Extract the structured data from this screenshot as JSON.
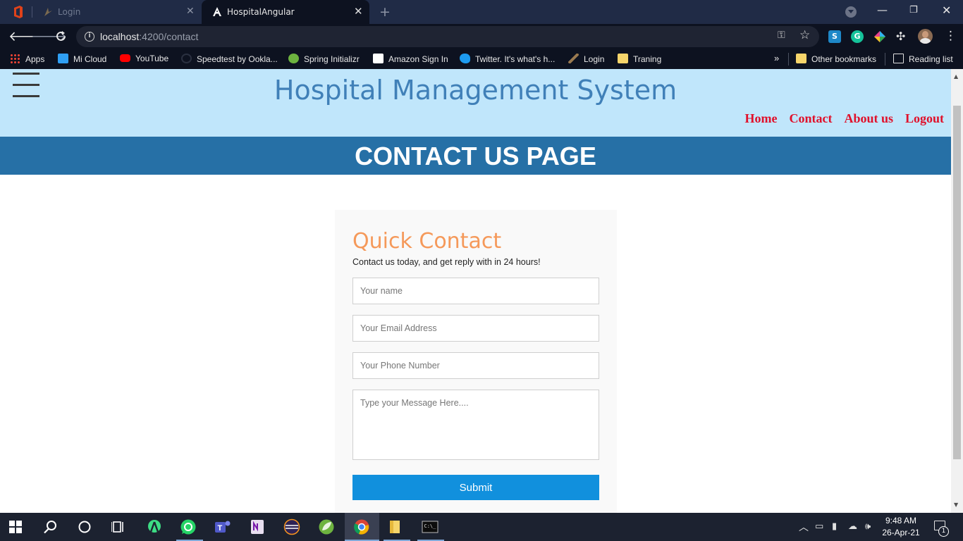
{
  "browser": {
    "tabs": [
      {
        "title": "Login",
        "active": false
      },
      {
        "title": "HospitalAngular",
        "active": true
      }
    ],
    "url_host": "localhost",
    "url_path": ":4200/contact",
    "bookmarks": [
      {
        "label": "Apps",
        "icon": "apps-grid-icon"
      },
      {
        "label": "Mi Cloud",
        "icon": "mi-cloud-icon"
      },
      {
        "label": "YouTube",
        "icon": "youtube-icon"
      },
      {
        "label": "Speedtest by Ookla...",
        "icon": "speedtest-icon"
      },
      {
        "label": "Spring Initializr",
        "icon": "spring-icon"
      },
      {
        "label": "Amazon Sign In",
        "icon": "amazon-icon"
      },
      {
        "label": "Twitter. It's what's h...",
        "icon": "twitter-icon"
      },
      {
        "label": "Login",
        "icon": "login-icon"
      },
      {
        "label": "Traning",
        "icon": "folder-icon"
      }
    ],
    "other_bookmarks": "Other bookmarks",
    "reading_list": "Reading list",
    "overflow": "»"
  },
  "page": {
    "site_title": "Hospital Management System",
    "nav": [
      "Home",
      "Contact",
      "About us",
      "Logout"
    ],
    "banner": "CONTACT US PAGE",
    "contact_form": {
      "heading": "Quick Contact",
      "subheading": "Contact us today, and get reply with in 24 hours!",
      "name_placeholder": "Your name",
      "email_placeholder": "Your Email Address",
      "phone_placeholder": "Your Phone Number",
      "message_placeholder": "Type your Message Here....",
      "submit_label": "Submit"
    }
  },
  "taskbar": {
    "time": "9:48 AM",
    "date": "26-Apr-21",
    "notification_count": "1",
    "pinned": [
      "windows-start-icon",
      "search-icon",
      "cortana-icon",
      "task-view-icon",
      "android-studio-icon",
      "whatsapp-icon",
      "teams-icon",
      "onenote-icon",
      "eclipse-icon",
      "spring-tool-icon",
      "chrome-icon",
      "file-explorer-icon",
      "terminal-icon"
    ]
  },
  "colors": {
    "header_bg": "#c0e6fb",
    "title_color": "#4080b8",
    "nav_color": "#e0102a",
    "banner_bg": "#2670a6",
    "heading_color": "#f5995a",
    "submit_bg": "#1190dd"
  }
}
